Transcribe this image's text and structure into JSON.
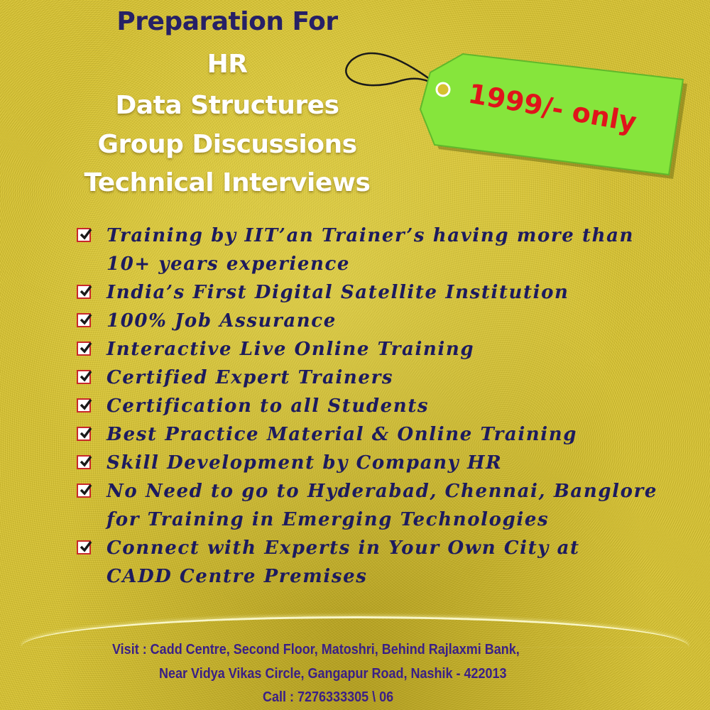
{
  "header": {
    "title": "Preparation For",
    "topics": [
      "HR",
      "Data Structures",
      "Group Discussions",
      "Technical Interviews"
    ]
  },
  "price_tag": {
    "text": "1999/- only",
    "tag_color": "#86e53c",
    "text_color": "#e0141b"
  },
  "features": [
    {
      "line1": "Training by IIT’an Trainer’s having more than",
      "line2": "10+ years experience"
    },
    {
      "line1": "India’s First Digital Satellite Institution"
    },
    {
      "line1": "100% Job Assurance"
    },
    {
      "line1": "Interactive Live Online Training"
    },
    {
      "line1": "Certified Expert Trainers"
    },
    {
      "line1": "Certification to all Students"
    },
    {
      "line1": "Best Practice Material & Online Training"
    },
    {
      "line1": "Skill Development by Company HR"
    },
    {
      "line1": "No Need to go to Hyderabad, Chennai, Banglore",
      "line2": "for Training in Emerging Technologies"
    },
    {
      "line1": "Connect with Experts in Your Own City at",
      "line2": "CADD Centre Premises"
    }
  ],
  "footer": {
    "address_line1": "Visit : Cadd Centre, Second Floor, Matoshri, Behind Rajlaxmi Bank,",
    "address_line2": "Near Vidya Vikas Circle, Gangapur Road, Nashik - 422013",
    "call": "Call : 7276333305 \\ 06"
  },
  "colors": {
    "background": "#d6c12f",
    "title": "#262066",
    "headline": "#ffffff",
    "feature_text": "#1d1b5e",
    "checkbox_border": "#c8282a",
    "footer_text": "#3a1f86"
  },
  "icons": {
    "checkbox": "checked-checkbox-icon",
    "tag": "price-tag-icon"
  }
}
